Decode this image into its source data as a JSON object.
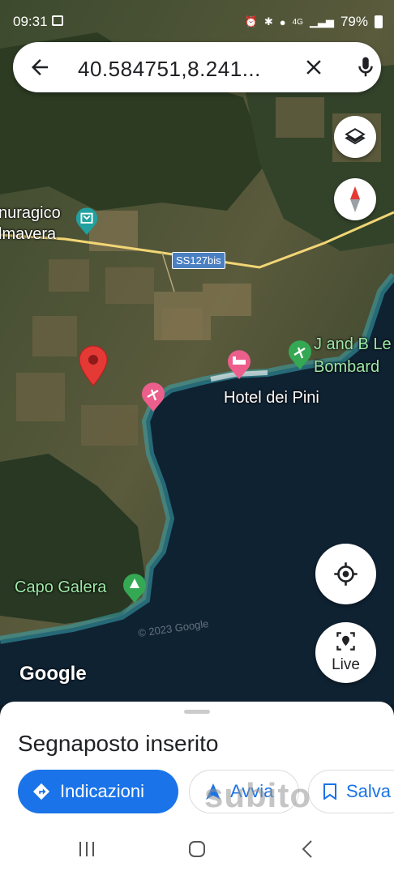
{
  "status_bar": {
    "time": "09:31",
    "battery": "79%",
    "network": "4G",
    "icons": [
      "gallery-icon",
      "alarm-icon",
      "bluetooth-icon",
      "location-icon",
      "signal-icon",
      "battery-icon"
    ]
  },
  "search": {
    "query": "40.584751,8.241..."
  },
  "map": {
    "labels": {
      "museum_line1": "nuragico",
      "museum_line2": "lmavera",
      "road": "SS127bis",
      "hotel": "Hotel dei Pini",
      "jb_line1": "J and B Le",
      "jb_line2": "Bombard",
      "capo": "Capo Galera",
      "copyright": "© 2023 Google",
      "google": "Google"
    },
    "colors": {
      "pin_red": "#e53935",
      "pin_pink": "#ec5e8c",
      "pin_green": "#34a853",
      "pin_teal": "#21a0a0",
      "sea": "#0f2232",
      "road": "#f2d675"
    }
  },
  "controls": {
    "live_label": "Live"
  },
  "sheet": {
    "title": "Segnaposto inserito",
    "directions_label": "Indicazioni",
    "start_label": "Avvia",
    "save_label": "Salva"
  },
  "watermark": "subito"
}
